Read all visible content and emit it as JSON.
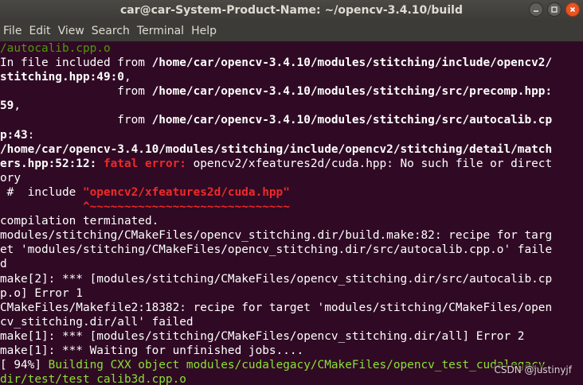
{
  "window": {
    "title": "car@car-System-Product-Name: ~/opencv-3.4.10/build",
    "buttons": {
      "minimize": "minimize-icon",
      "maximize": "maximize-icon",
      "close": "close-icon"
    }
  },
  "menu": [
    "File",
    "Edit",
    "View",
    "Search",
    "Terminal",
    "Help"
  ],
  "terminal": {
    "lines": [
      [
        {
          "t": "/autocalib.cpp.o",
          "c": "g2"
        }
      ],
      [
        {
          "t": "In file included from "
        },
        {
          "t": "/home/car/opencv-3.4.10/modules/stitching/include/opencv2/",
          "c": "b"
        }
      ],
      [
        {
          "t": "stitching.hpp:49:0",
          "c": "b"
        },
        {
          "t": ","
        }
      ],
      [
        {
          "t": "                 from "
        },
        {
          "t": "/home/car/opencv-3.4.10/modules/stitching/src/precomp.hpp:",
          "c": "b"
        }
      ],
      [
        {
          "t": "59",
          "c": "b"
        },
        {
          "t": ","
        }
      ],
      [
        {
          "t": "                 from "
        },
        {
          "t": "/home/car/opencv-3.4.10/modules/stitching/src/autocalib.cp",
          "c": "b"
        }
      ],
      [
        {
          "t": "p:43",
          "c": "b"
        },
        {
          "t": ":"
        }
      ],
      [
        {
          "t": "/home/car/opencv-3.4.10/modules/stitching/include/opencv2/stitching/detail/match",
          "c": "b"
        }
      ],
      [
        {
          "t": "ers.hpp:52:12:",
          "c": "b"
        },
        {
          "t": " "
        },
        {
          "t": "fatal error:",
          "c": "r"
        },
        {
          "t": " opencv2/xfeatures2d/cuda.hpp: No such file or direct"
        }
      ],
      [
        {
          "t": "ory"
        }
      ],
      [
        {
          "t": " #  include "
        },
        {
          "t": "\"opencv2/xfeatures2d/cuda.hpp\"",
          "c": "r"
        }
      ],
      [
        {
          "t": "            "
        },
        {
          "t": "^~~~~~~~~~~~~~~~~~~~~~~~~~~~~~",
          "c": "r"
        }
      ],
      [
        {
          "t": "compilation terminated."
        }
      ],
      [
        {
          "t": "modules/stitching/CMakeFiles/opencv_stitching.dir/build.make:82: recipe for targ"
        }
      ],
      [
        {
          "t": "et 'modules/stitching/CMakeFiles/opencv_stitching.dir/src/autocalib.cpp.o' faile"
        }
      ],
      [
        {
          "t": "d"
        }
      ],
      [
        {
          "t": "make[2]: *** [modules/stitching/CMakeFiles/opencv_stitching.dir/src/autocalib.cp"
        }
      ],
      [
        {
          "t": "p.o] Error 1"
        }
      ],
      [
        {
          "t": "CMakeFiles/Makefile2:18382: recipe for target 'modules/stitching/CMakeFiles/open"
        }
      ],
      [
        {
          "t": "cv_stitching.dir/all' failed"
        }
      ],
      [
        {
          "t": "make[1]: *** [modules/stitching/CMakeFiles/opencv_stitching.dir/all] Error 2"
        }
      ],
      [
        {
          "t": "make[1]: *** Waiting for unfinished jobs...."
        }
      ],
      [
        {
          "t": "[ 94%] "
        },
        {
          "t": "Building CXX object modules/cudalegacy/CMakeFiles/opencv_test_cudalegacy.",
          "c": "g"
        }
      ],
      [
        {
          "t": "dir/test/test_calib3d.cpp.o",
          "c": "g"
        }
      ]
    ]
  },
  "watermark": "CSDN @justinyjf"
}
